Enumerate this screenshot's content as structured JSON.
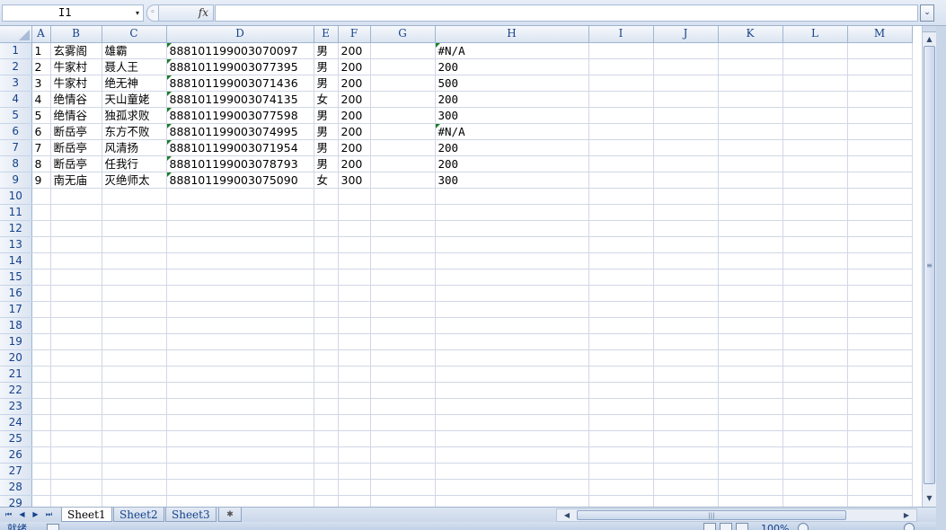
{
  "formula_bar": {
    "name_box": "I1",
    "fx_label": "fx",
    "formula_value": ""
  },
  "columns": [
    {
      "label": "A",
      "width": 21
    },
    {
      "label": "B",
      "width": 57
    },
    {
      "label": "C",
      "width": 72
    },
    {
      "label": "D",
      "width": 164
    },
    {
      "label": "E",
      "width": 27
    },
    {
      "label": "F",
      "width": 36
    },
    {
      "label": "G",
      "width": 72
    },
    {
      "label": "H",
      "width": 171
    },
    {
      "label": "I",
      "width": 72
    },
    {
      "label": "J",
      "width": 72
    },
    {
      "label": "K",
      "width": 72
    },
    {
      "label": "L",
      "width": 72
    },
    {
      "label": "M",
      "width": 72
    }
  ],
  "row_count": 29,
  "cells": [
    [
      "1",
      "玄雾阁",
      "雄霸",
      "888101199003070097",
      "男",
      "200",
      "",
      "#N/A"
    ],
    [
      "2",
      "牛家村",
      "聂人王",
      "888101199003077395",
      "男",
      "200",
      "",
      "200"
    ],
    [
      "3",
      "牛家村",
      "绝无神",
      "888101199003071436",
      "男",
      "200",
      "",
      "500"
    ],
    [
      "4",
      "绝情谷",
      "天山童姥",
      "888101199003074135",
      "女",
      "200",
      "",
      "200"
    ],
    [
      "5",
      "绝情谷",
      "独孤求败",
      "888101199003077598",
      "男",
      "200",
      "",
      "300"
    ],
    [
      "6",
      "断岳亭",
      "东方不败",
      "888101199003074995",
      "男",
      "200",
      "",
      "#N/A"
    ],
    [
      "7",
      "断岳亭",
      "风清扬",
      "888101199003071954",
      "男",
      "200",
      "",
      "200"
    ],
    [
      "8",
      "断岳亭",
      "任我行",
      "888101199003078793",
      "男",
      "200",
      "",
      "200"
    ],
    [
      "9",
      "南无庙",
      "灭绝师太",
      "888101199003075090",
      "女",
      "300",
      "",
      "300"
    ]
  ],
  "sheet_tabs": [
    {
      "label": "Sheet1",
      "active": true
    },
    {
      "label": "Sheet2",
      "active": false
    },
    {
      "label": "Sheet3",
      "active": false
    }
  ],
  "status_bar": {
    "ready_text": "就绪",
    "zoom": "100%"
  },
  "icons": {
    "dropdown": "▾",
    "expand": "⌄",
    "scroll_up": "▲",
    "scroll_down": "▼",
    "scroll_left": "◀",
    "scroll_right": "▶",
    "tab_first": "⏮",
    "tab_prev": "◀",
    "tab_next": "▶",
    "tab_last": "⏭",
    "grip_v": "≡",
    "grip_h": "|||",
    "new_sheet": "✱"
  }
}
